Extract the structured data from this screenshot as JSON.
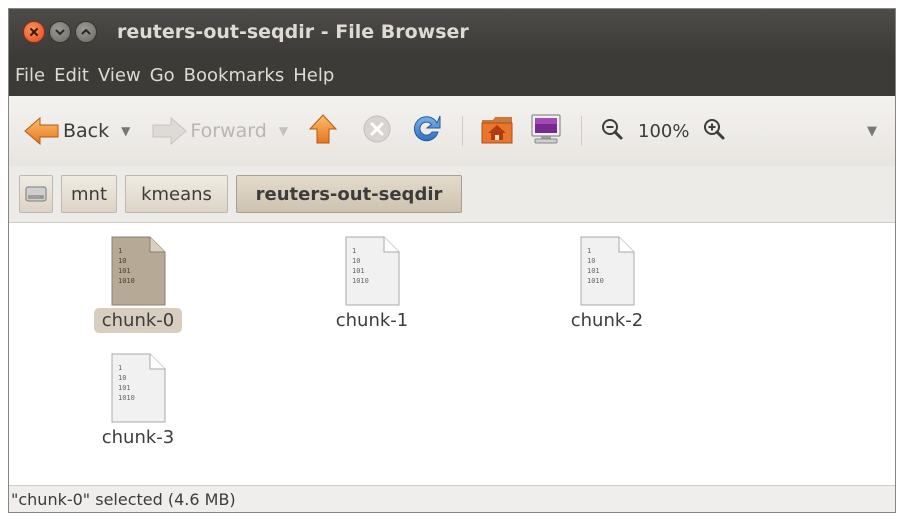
{
  "window": {
    "title": "reuters-out-seqdir - File Browser",
    "controls": [
      "close-icon",
      "minimize-icon",
      "maximize-icon"
    ]
  },
  "menubar": {
    "items": [
      "File",
      "Edit",
      "View",
      "Go",
      "Bookmarks",
      "Help"
    ]
  },
  "toolbar": {
    "back_label": "Back",
    "forward_label": "Forward",
    "zoom_level": "100%",
    "icons": [
      "back-arrow-icon",
      "forward-arrow-icon",
      "up-arrow-icon",
      "stop-icon",
      "reload-icon",
      "home-icon",
      "computer-icon",
      "zoom-out-icon",
      "zoom-in-icon",
      "toolbar-overflow-icon"
    ]
  },
  "pathbar": {
    "crumbs": [
      "mnt",
      "kmeans",
      "reuters-out-seqdir"
    ],
    "root_icon": "drive-icon"
  },
  "files": [
    {
      "name": "chunk-0",
      "selected": true,
      "icon": "binary-file-icon",
      "icon_lines": [
        "1",
        "10",
        "101",
        "1010"
      ]
    },
    {
      "name": "chunk-1",
      "selected": false,
      "icon": "binary-file-icon",
      "icon_lines": [
        "1",
        "10",
        "101",
        "1010"
      ]
    },
    {
      "name": "chunk-2",
      "selected": false,
      "icon": "binary-file-icon",
      "icon_lines": [
        "1",
        "10",
        "101",
        "1010"
      ]
    },
    {
      "name": "chunk-3",
      "selected": false,
      "icon": "binary-file-icon",
      "icon_lines": [
        "1",
        "10",
        "101",
        "1010"
      ]
    }
  ],
  "status": "\"chunk-0\" selected (4.6 MB)",
  "colors": {
    "titlebar": "#3c3b37",
    "title_text": "#dfdbd2",
    "selection": "#d7cebf",
    "close_button": "#e0491b",
    "home_orange": "#e9762c"
  }
}
